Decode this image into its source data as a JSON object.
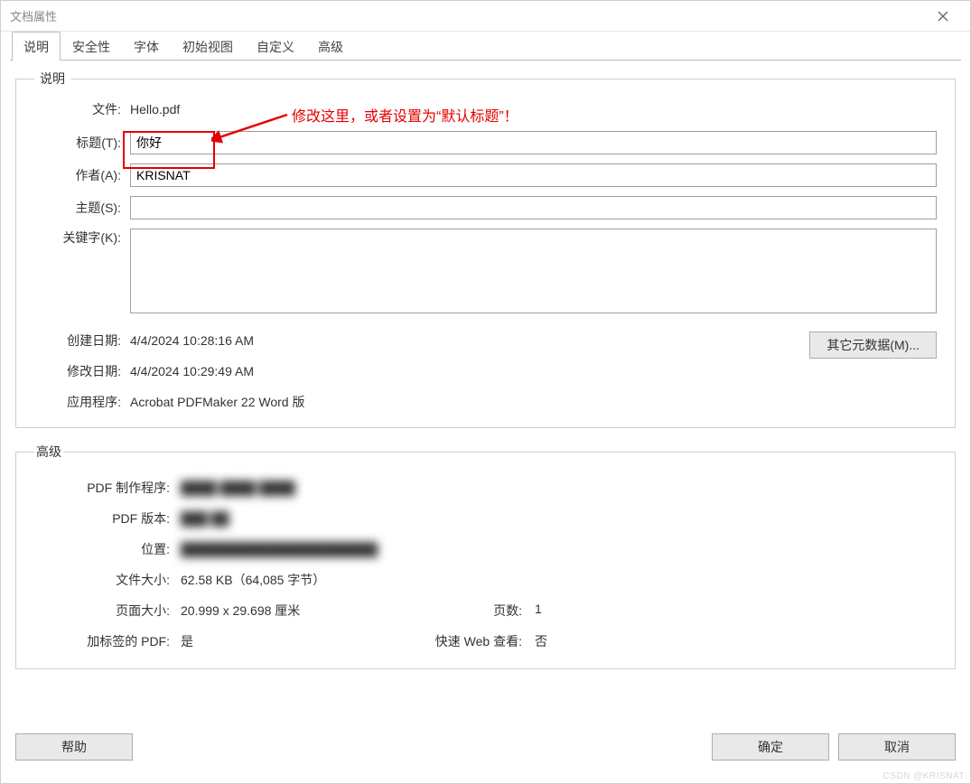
{
  "window": {
    "title": "文档属性"
  },
  "tabs": [
    "说明",
    "安全性",
    "字体",
    "初始视图",
    "自定义",
    "高级"
  ],
  "active_tab_index": 0,
  "group_desc": {
    "legend": "说明",
    "file_label": "文件:",
    "file_value": "Hello.pdf",
    "title_label": "标题(T):",
    "title_value": "你好",
    "author_label": "作者(A):",
    "author_value": "KRISNAT",
    "subject_label": "主题(S):",
    "subject_value": "",
    "keywords_label": "关键字(K):",
    "keywords_value": "",
    "created_label": "创建日期:",
    "created_value": "4/4/2024 10:28:16 AM",
    "modified_label": "修改日期:",
    "modified_value": "4/4/2024 10:29:49 AM",
    "app_label": "应用程序:",
    "app_value": "Acrobat PDFMaker 22 Word 版",
    "meta_button": "其它元数据(M)..."
  },
  "group_adv": {
    "legend": "高级",
    "producer_label": "PDF 制作程序:",
    "producer_value": "████ ████ ████",
    "version_label": "PDF 版本:",
    "version_value": "███ ██",
    "location_label": "位置:",
    "location_value": "██████████████████████",
    "filesize_label": "文件大小:",
    "filesize_value": "62.58 KB（64,085 字节）",
    "pagesize_label": "页面大小:",
    "pagesize_value": "20.999 x 29.698 厘米",
    "pages_label": "页数:",
    "pages_value": "1",
    "tagged_label": "加标签的 PDF:",
    "tagged_value": "是",
    "fastview_label": "快速 Web 查看:",
    "fastview_value": "否"
  },
  "footer": {
    "help": "帮助",
    "ok": "确定",
    "cancel": "取消"
  },
  "annotation": {
    "text": "修改这里，或者设置为“默认标题”！"
  },
  "watermark": "CSDN @KRISNAT"
}
